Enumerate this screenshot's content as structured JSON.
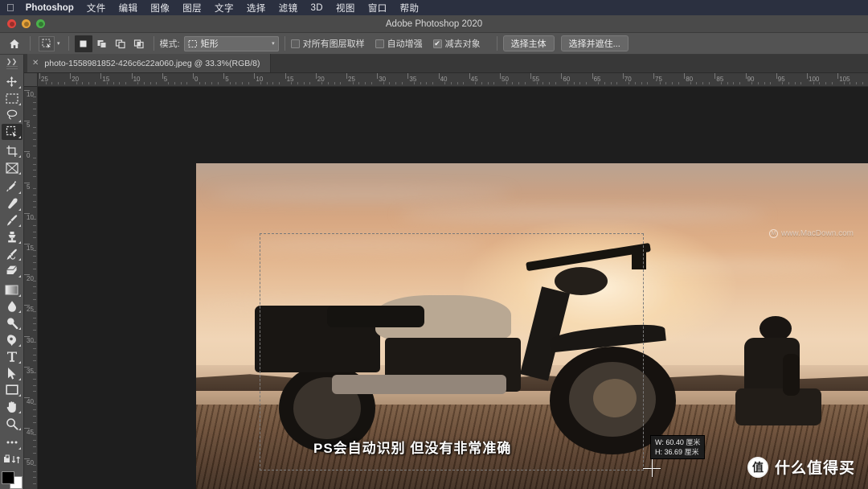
{
  "menubar": {
    "apple_icon": "apple-logo",
    "app_name": "Photoshop",
    "items": [
      "文件",
      "编辑",
      "图像",
      "图层",
      "文字",
      "选择",
      "滤镜",
      "3D",
      "视图",
      "窗口",
      "帮助"
    ]
  },
  "window": {
    "title": "Adobe Photoshop 2020",
    "close_label": "",
    "minimize_label": "",
    "zoom_label": ""
  },
  "options_bar": {
    "home_icon": "home-icon",
    "tool_preset_icon": "object-selection-tool-icon",
    "preset_chevron": "▾",
    "bool_modes": [
      {
        "name": "new-selection",
        "icon": "square-filled-icon",
        "active": true
      },
      {
        "name": "add-to-selection",
        "icon": "add-squares-icon",
        "active": false
      },
      {
        "name": "subtract-from-selection",
        "icon": "subtract-squares-icon",
        "active": false
      },
      {
        "name": "intersect-selection",
        "icon": "intersect-squares-icon",
        "active": false
      }
    ],
    "mode_label": "模式:",
    "mode_value": "矩形",
    "mode_chevron": "▾",
    "checkboxes": [
      {
        "label": "对所有图层取样",
        "checked": false
      },
      {
        "label": "自动增强",
        "checked": false
      },
      {
        "label": "减去对象",
        "checked": true
      }
    ],
    "check_glyph": "✔",
    "buttons": [
      "选择主体",
      "选择并遮住..."
    ]
  },
  "document_tab": {
    "close_glyph": "✕",
    "title": "photo-1558981852-426c6c22a060.jpeg @ 33.3%(RGB/8)"
  },
  "toolbar": {
    "collapse_glyph": "❯❯",
    "tools": [
      {
        "name": "move-tool",
        "icon": "move-icon",
        "active": false
      },
      {
        "name": "rectangular-marquee-tool",
        "icon": "marquee-icon",
        "active": false
      },
      {
        "name": "lasso-tool",
        "icon": "lasso-icon",
        "active": false
      },
      {
        "name": "object-selection-tool",
        "icon": "object-selection-icon",
        "active": true
      },
      {
        "name": "crop-tool",
        "icon": "crop-icon",
        "active": false
      },
      {
        "name": "frame-tool",
        "icon": "frame-icon",
        "active": false
      },
      {
        "name": "eyedropper-tool",
        "icon": "eyedropper-icon",
        "active": false
      },
      {
        "name": "spot-healing-brush-tool",
        "icon": "healing-brush-icon",
        "active": false
      },
      {
        "name": "brush-tool",
        "icon": "brush-icon",
        "active": false
      },
      {
        "name": "clone-stamp-tool",
        "icon": "clone-stamp-icon",
        "active": false
      },
      {
        "name": "history-brush-tool",
        "icon": "history-brush-icon",
        "active": false
      },
      {
        "name": "eraser-tool",
        "icon": "eraser-icon",
        "active": false
      },
      {
        "name": "gradient-tool",
        "icon": "gradient-icon",
        "active": false
      },
      {
        "name": "blur-tool",
        "icon": "droplet-icon",
        "active": false
      },
      {
        "name": "dodge-tool",
        "icon": "dodge-icon",
        "active": false
      },
      {
        "name": "pen-tool",
        "icon": "pen-icon",
        "active": false
      },
      {
        "name": "type-tool",
        "icon": "type-t-icon",
        "active": false
      },
      {
        "name": "path-selection-tool",
        "icon": "path-arrow-icon",
        "active": false
      },
      {
        "name": "rectangle-tool",
        "icon": "rectangle-icon",
        "active": false
      },
      {
        "name": "hand-tool",
        "icon": "hand-icon",
        "active": false
      },
      {
        "name": "zoom-tool",
        "icon": "magnifier-icon",
        "active": false
      },
      {
        "name": "edit-toolbar",
        "icon": "ellipsis-icon",
        "active": false
      },
      {
        "name": "quick-mask-toggle",
        "icon": "quick-mask-icon",
        "active": false
      },
      {
        "name": "screen-mode",
        "icon": "screen-mode-icon",
        "active": false
      }
    ],
    "foreground_color": "#000000",
    "background_color": "#ffffff"
  },
  "rulers": {
    "unit": "厘米",
    "horizontal_labels": [
      "25",
      "20",
      "15",
      "10",
      "5",
      "0",
      "5",
      "10",
      "15",
      "20",
      "25",
      "30",
      "35",
      "40",
      "45",
      "50",
      "55",
      "60",
      "65",
      "70",
      "75",
      "80",
      "85",
      "90",
      "95",
      "100",
      "105"
    ],
    "vertical_labels": [
      "10",
      "5",
      "0",
      "5",
      "10",
      "15",
      "20",
      "25",
      "30",
      "35",
      "40",
      "45",
      "50"
    ]
  },
  "canvas": {
    "watermark": "www.MacDown.com",
    "watermark_badge": "M",
    "subtitle": "PS会自动识别 但没有非常准确",
    "info_tip": {
      "width_label": "W:",
      "width_value": "60.40",
      "width_unit": "厘米",
      "height_label": "H:",
      "height_value": "36.69",
      "height_unit": "厘米"
    },
    "cursor": "crosshair-cursor"
  },
  "site_logo": {
    "badge": "值",
    "text": "什么值得买"
  },
  "colors": {
    "menubar_bg": "#2b3040",
    "titlebar_bg": "#4a4a4a",
    "options_bg": "#535353",
    "canvas_bg": "#1e1e1e",
    "accent_active": "#2e2e2e"
  }
}
